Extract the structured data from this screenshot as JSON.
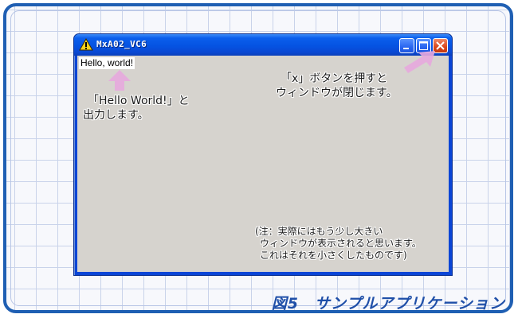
{
  "window": {
    "title": "MxA02_VC6",
    "client_text": "Hello, world!"
  },
  "annotations": {
    "hello_note": [
      "「Hello World!」と",
      "出力します。"
    ],
    "close_note": [
      "「x」ボタンを押すと",
      "ウィンドウが閉じます。"
    ],
    "size_note": [
      "(注：実際にはもう少し大きい",
      "ウィンドウが表示されると思います。",
      "これはそれを小さくしたものです)"
    ]
  },
  "caption": "図5　サンプルアプリケーション",
  "colors": {
    "frame": "#1f5fb3",
    "titlebar": "#0553e2",
    "client": "#d6d3ce",
    "arrow": "#e7a9de",
    "caption": "#1f4fa8"
  },
  "icons": {
    "title": "warning-icon",
    "minimize": "minimize-icon",
    "maximize": "maximize-icon",
    "close": "close-icon"
  }
}
